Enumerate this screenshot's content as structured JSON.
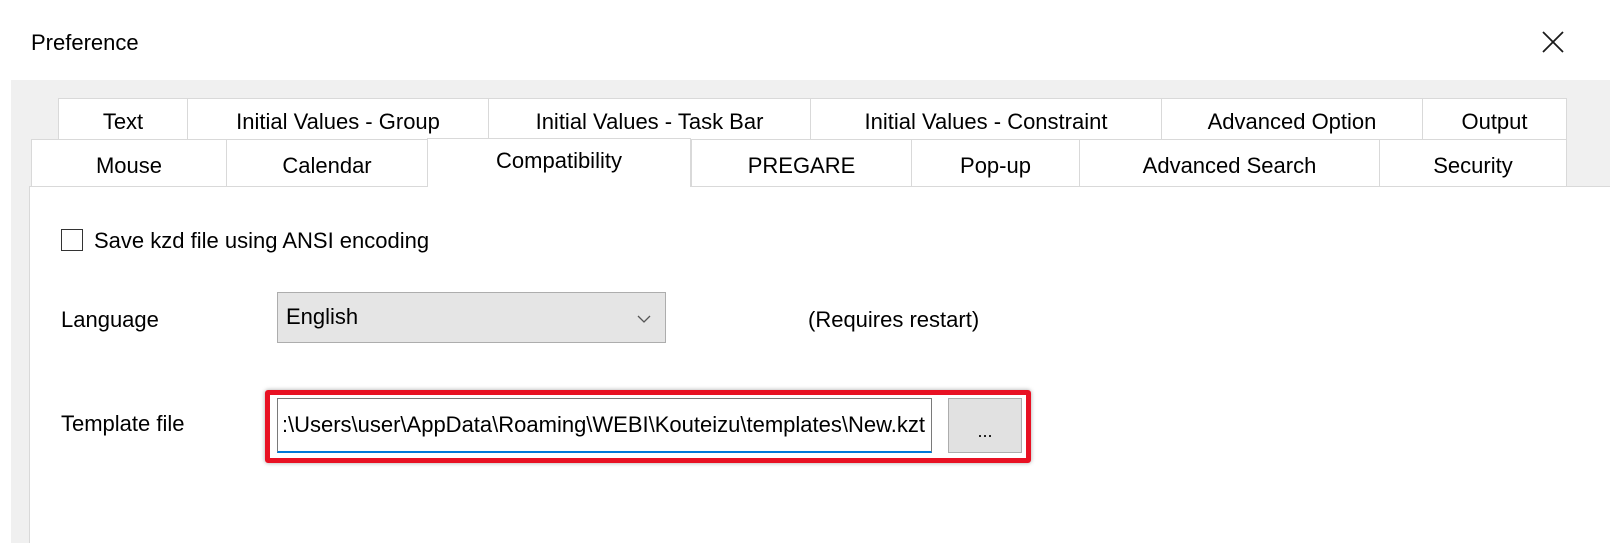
{
  "window": {
    "title": "Preference",
    "close_icon": "close-icon"
  },
  "tabs": {
    "row1": [
      {
        "label": "Text"
      },
      {
        "label": "Initial Values - Group"
      },
      {
        "label": "Initial Values - Task Bar"
      },
      {
        "label": "Initial Values - Constraint"
      },
      {
        "label": "Advanced Option"
      },
      {
        "label": "Output"
      }
    ],
    "row2": [
      {
        "label": "Mouse"
      },
      {
        "label": "Calendar"
      },
      {
        "label": "Compatibility",
        "active": true
      },
      {
        "label": "PREGARE"
      },
      {
        "label": "Pop-up"
      },
      {
        "label": "Advanced Search"
      },
      {
        "label": "Security"
      }
    ]
  },
  "compatibility": {
    "ansi_checkbox": {
      "label": "Save kzd file using ANSI encoding",
      "checked": false
    },
    "language": {
      "label": "Language",
      "selected": "English",
      "note": "(Requires restart)",
      "icon": "chevron-down-icon"
    },
    "template": {
      "label": "Template file",
      "value": "C:\\Users\\user\\AppData\\Roaming\\WEBI\\Kouteizu\\templates\\New.kzt",
      "browse_label": "..."
    }
  },
  "colors": {
    "highlight": "#e81123",
    "focus_underline": "#0078d7"
  }
}
